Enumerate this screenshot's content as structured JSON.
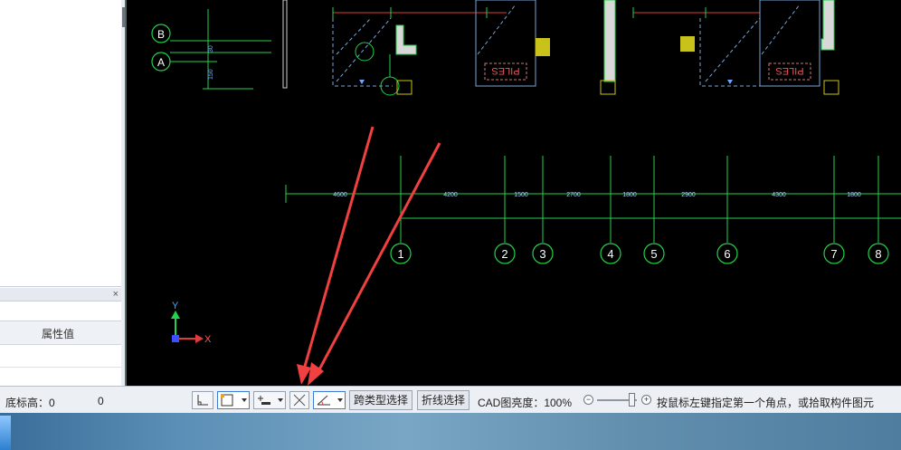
{
  "properties_panel": {
    "close_glyph": "×",
    "column_header": "属性值"
  },
  "drawing": {
    "axis_labels": {
      "y": "Y",
      "x": "X"
    },
    "row_bubbles": [
      "B",
      "A"
    ],
    "small_dims": [
      "30",
      "150"
    ],
    "pile_text": "PILES",
    "grid_bubbles": [
      "1",
      "2",
      "3",
      "4",
      "5",
      "6",
      "7",
      "8"
    ],
    "spans": [
      "4600",
      "4200",
      "1500",
      "2700",
      "1800",
      "2900",
      "4300",
      "1800"
    ],
    "colors": {
      "grid": "#22d24a",
      "dim_line": "#e03a3a",
      "column_fill": "#d8d8d8",
      "highlight": "#c8c21a",
      "arrow": "#f04040"
    }
  },
  "statusbar": {
    "bottom_elevation_label": "底标高：0",
    "value": "0",
    "cross_type_select": "跨类型选择",
    "polyline_select": "折线选择",
    "cad_brightness": "CAD图亮度：100%",
    "minus": "−",
    "plus": "+",
    "hint": "按鼠标左键指定第一个角点，或拾取构件图元"
  }
}
